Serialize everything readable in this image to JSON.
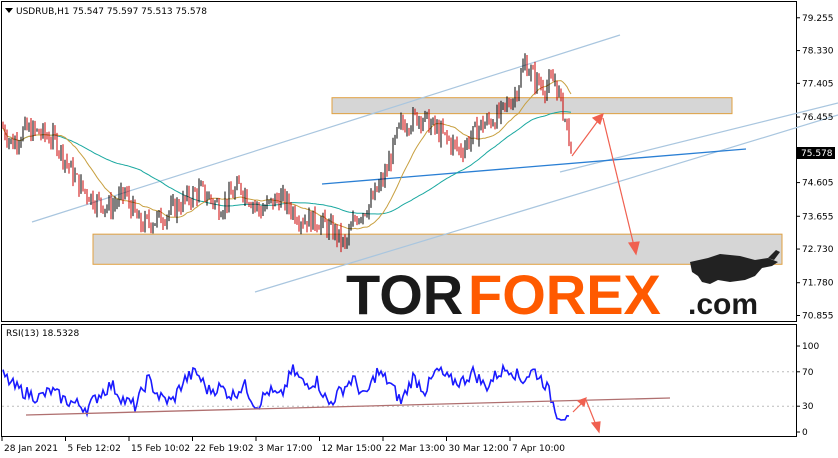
{
  "header": {
    "symbol_line": "USDRUB,H1  75.547 75.597 75.513 75.578",
    "rsi_label": "RSI(13) 18.5328"
  },
  "logo": {
    "part1": "TOR",
    "part2": "FOREX",
    "part3": ".com"
  },
  "colors": {
    "bull_candle": "#000000",
    "bear_candle": "#cc0000",
    "ma_fast": "#c8a040",
    "ma_slow": "#1aa8a0",
    "channel": "#a9c6df",
    "trendline": "#2a7fd4",
    "zone_fill": "#d6d6d6",
    "zone_border": "#e0a040",
    "forecast_arrow": "#f06050",
    "rsi_line": "#1a1aff",
    "rsi_trendline": "#b07070",
    "price_label_bg": "#000000",
    "logo_orange": "#ff5a00"
  },
  "chart_data": {
    "type": "line",
    "symbol": "USDRUB",
    "timeframe": "H1",
    "ohlc": {
      "open": 75.547,
      "high": 75.597,
      "low": 75.513,
      "close": 75.578
    },
    "current_price_label": "75.578",
    "y_ticks": [
      "79.255",
      "78.330",
      "77.405",
      "76.455",
      "75.578",
      "74.605",
      "73.655",
      "72.730",
      "71.780",
      "70.855"
    ],
    "y_tick_values": [
      79.255,
      78.33,
      77.405,
      76.455,
      75.578,
      74.605,
      73.655,
      72.73,
      71.78,
      70.855
    ],
    "ylim": [
      70.7,
      79.7
    ],
    "x_ticks": [
      "28 Jan 2021",
      "5 Feb 12:02",
      "15 Feb 10:02",
      "22 Feb 19:02",
      "3 Mar 17:00",
      "12 Mar 15:00",
      "22 Mar 13:00",
      "30 Mar 12:00",
      "7 Apr 10:00"
    ],
    "price_series_x": [
      0,
      12,
      25,
      40,
      55,
      68,
      80,
      95,
      110,
      125,
      140,
      160,
      180,
      200,
      220,
      240,
      260,
      280,
      300,
      320,
      335,
      345,
      355,
      370,
      385,
      400,
      420,
      440,
      460,
      480,
      500,
      515,
      525,
      535,
      545,
      555,
      565,
      572
    ],
    "price_series": [
      76.3,
      75.7,
      76.1,
      76.0,
      75.8,
      75.1,
      74.5,
      74.1,
      73.9,
      74.3,
      73.4,
      73.6,
      74.0,
      74.4,
      73.9,
      74.5,
      73.8,
      74.2,
      73.6,
      73.5,
      73.2,
      72.8,
      73.6,
      74.0,
      74.8,
      76.2,
      76.5,
      76.0,
      75.5,
      76.2,
      76.5,
      77.1,
      78.0,
      77.5,
      77.3,
      77.5,
      76.4,
      75.578
    ],
    "zones": [
      {
        "name": "resistance",
        "from": 76.55,
        "to": 77.0
      },
      {
        "name": "support",
        "from": 72.3,
        "to": 73.15
      }
    ],
    "rsi": {
      "period": 13,
      "value": 18.5328,
      "levels": [
        70,
        30
      ],
      "y_ticks": [
        "100",
        "70",
        "30",
        "0"
      ],
      "y_tick_values": [
        100,
        70,
        30,
        0
      ],
      "ylim": [
        0,
        100
      ],
      "series": [
        66,
        52,
        45,
        40,
        48,
        38,
        33,
        28,
        44,
        55,
        37,
        30,
        62,
        40,
        35,
        60,
        70,
        48,
        52,
        42,
        55,
        30,
        48,
        40,
        72,
        55,
        60,
        32,
        48,
        62,
        40,
        70,
        58,
        35,
        64,
        48,
        72,
        60,
        58,
        70,
        52,
        68,
        75,
        60,
        72,
        55,
        20,
        18.5
      ]
    }
  }
}
